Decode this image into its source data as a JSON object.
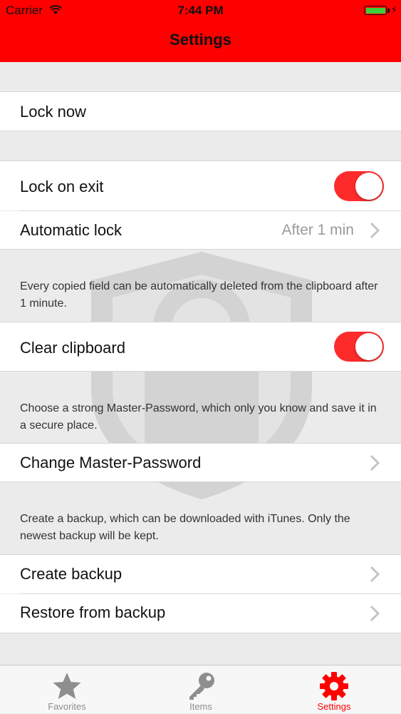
{
  "status_bar": {
    "carrier": "Carrier",
    "time": "7:44 PM"
  },
  "nav": {
    "title": "Settings"
  },
  "rows": {
    "lock_now": "Lock now",
    "lock_on_exit": "Lock on exit",
    "automatic_lock": "Automatic lock",
    "automatic_lock_value": "After 1 min",
    "clear_clipboard": "Clear clipboard",
    "change_master_password": "Change Master-Password",
    "create_backup": "Create backup",
    "restore_backup": "Restore from backup"
  },
  "toggles": {
    "lock_on_exit": true,
    "clear_clipboard": true
  },
  "notes": {
    "clipboard": "Every copied field can be automatically deleted from the clipboard after 1 minute.",
    "password": "Choose a strong Master-Password, which only you know and save it in a secure place.",
    "backup": "Create a backup, which can be downloaded with iTunes. Only the newest backup will be kept."
  },
  "tabs": [
    {
      "label": "Favorites",
      "icon": "star-icon",
      "active": false
    },
    {
      "label": "Items",
      "icon": "key-icon",
      "active": false
    },
    {
      "label": "Settings",
      "icon": "gear-icon",
      "active": true
    }
  ],
  "colors": {
    "accent": "#fe0000",
    "toggle_on": "#fe2b2b",
    "background": "#ebebeb"
  }
}
